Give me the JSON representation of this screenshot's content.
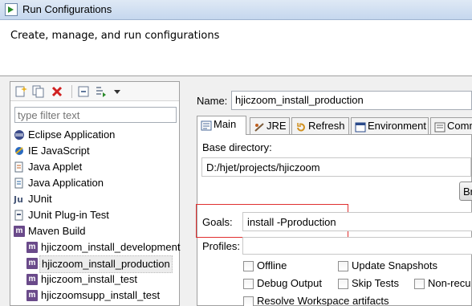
{
  "window": {
    "title": "Run Configurations"
  },
  "header": {
    "text": "Create, manage, and run configurations"
  },
  "left": {
    "filter_placeholder": "type filter text",
    "tree": [
      {
        "label": "Eclipse Application",
        "icon": "eclipse-icon"
      },
      {
        "label": "IE JavaScript",
        "icon": "ie-javascript-icon"
      },
      {
        "label": "Java Applet",
        "icon": "java-applet-icon"
      },
      {
        "label": "Java Application",
        "icon": "java-application-icon"
      },
      {
        "label": "JUnit",
        "icon": "junit-icon"
      },
      {
        "label": "JUnit Plug-in Test",
        "icon": "junit-plugin-icon"
      },
      {
        "label": "Maven Build",
        "icon": "maven-icon"
      },
      {
        "label": "hjiczoom_install_development",
        "icon": "maven-icon"
      },
      {
        "label": "hjiczoom_install_production",
        "icon": "maven-icon",
        "selected": true
      },
      {
        "label": "hjiczoom_install_test",
        "icon": "maven-icon"
      },
      {
        "label": "hjiczoomsupp_install_test",
        "icon": "maven-icon"
      }
    ]
  },
  "right": {
    "name_label": "Name:",
    "name_value": "hjiczoom_install_production",
    "tabs": [
      {
        "label": "Main",
        "icon": "main-tab-icon",
        "active": true
      },
      {
        "label": "JRE",
        "icon": "jre-icon"
      },
      {
        "label": "Refresh",
        "icon": "refresh-icon"
      },
      {
        "label": "Environment",
        "icon": "environment-icon"
      },
      {
        "label": "Comm",
        "icon": "common-icon"
      }
    ],
    "base_dir_label": "Base directory:",
    "base_dir_value": "D:/hjet/projects/hjiczoom",
    "browse_label": "Br",
    "goals_label": "Goals:",
    "goals_value": "install -Pproduction",
    "profiles_label": "Profiles:",
    "profiles_value": "",
    "checkboxes": {
      "offline": "Offline",
      "update_snapshots": "Update Snapshots",
      "debug_output": "Debug Output",
      "skip_tests": "Skip Tests",
      "non_recursive": "Non-recu",
      "resolve_workspace": "Resolve Workspace artifacts"
    }
  },
  "colors": {
    "highlight_box": "#e03030",
    "maven_badge": "#6a4a8a"
  }
}
